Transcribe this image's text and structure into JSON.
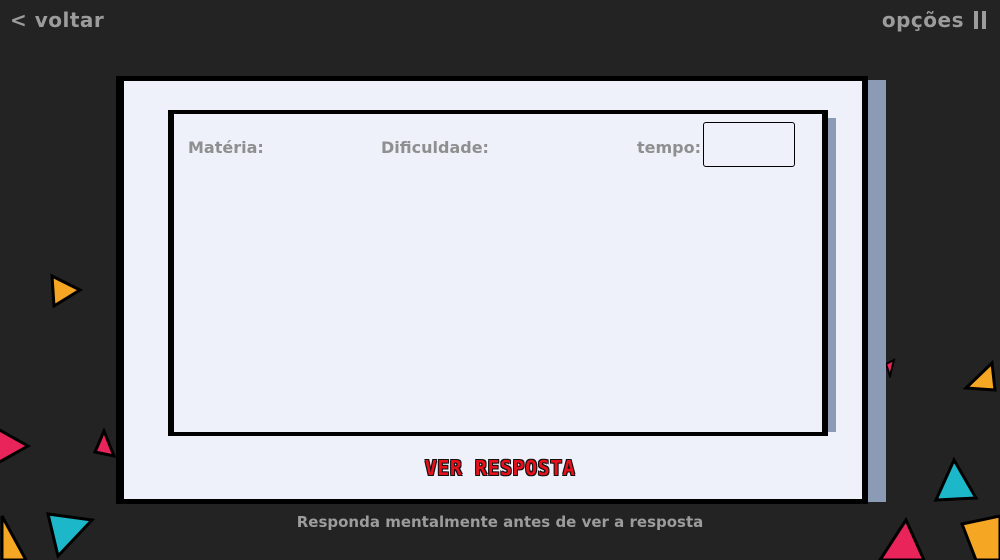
{
  "nav": {
    "back_label": "< voltar",
    "options_label": "opções"
  },
  "card": {
    "materia_label": "Matéria:",
    "dificuldade_label": "Dificuldade:",
    "tempo_label": "tempo:",
    "tempo_value": ""
  },
  "reveal_button_label": "VER RESPOSTA",
  "hint": "Responda mentalmente antes de ver a resposta",
  "colors": {
    "background": "#232323",
    "card": "#eef0fa",
    "accent_red": "#e8101a",
    "triangle_orange": "#f5a623",
    "triangle_teal": "#1cb8c9",
    "triangle_pink": "#e8245a"
  }
}
